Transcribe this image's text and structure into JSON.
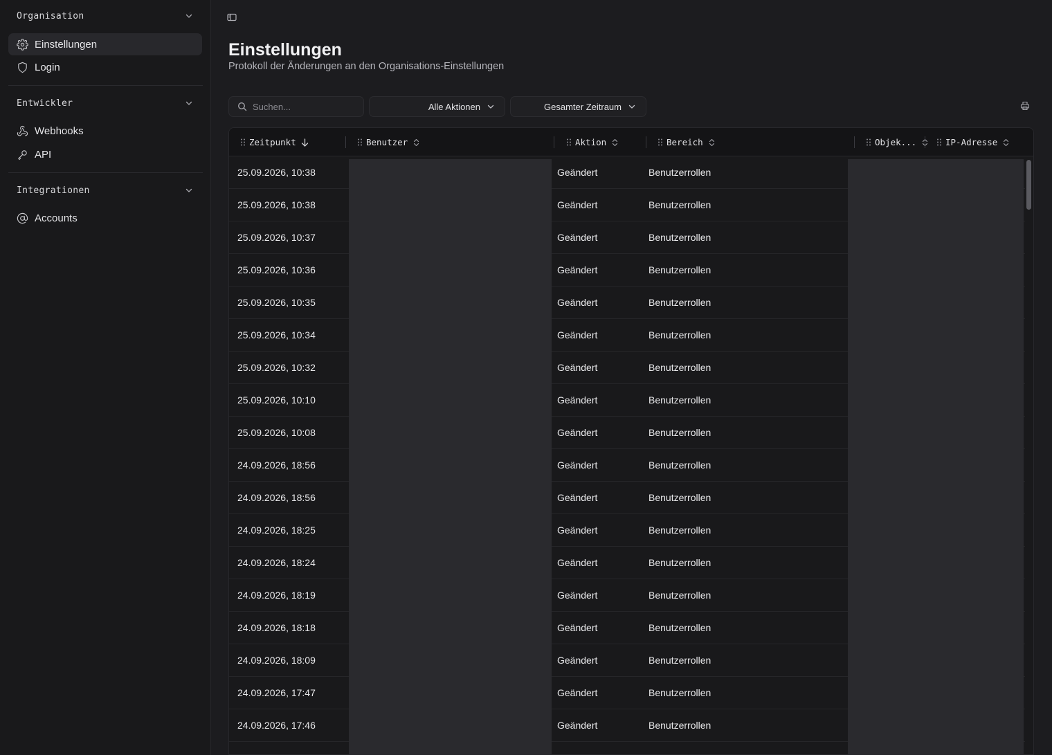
{
  "sidebar": {
    "groups": [
      {
        "title": "Organisation",
        "items": [
          {
            "label": "Einstellungen",
            "icon": "gear-icon",
            "active": true
          },
          {
            "label": "Login",
            "icon": "shield-icon",
            "active": false
          }
        ]
      },
      {
        "title": "Entwickler",
        "items": [
          {
            "label": "Webhooks",
            "icon": "webhook-icon",
            "active": false
          },
          {
            "label": "API",
            "icon": "key-icon",
            "active": false
          }
        ]
      },
      {
        "title": "Integrationen",
        "items": [
          {
            "label": "Accounts",
            "icon": "at-sign-icon",
            "active": false
          }
        ]
      }
    ]
  },
  "header": {
    "title": "Einstellungen",
    "subtitle": "Protokoll der Änderungen an den Organisations-Einstellungen"
  },
  "toolbar": {
    "search_placeholder": "Suchen...",
    "action_filter": "Alle Aktionen",
    "period_filter": "Gesamter Zeitraum"
  },
  "table": {
    "columns": [
      "Zeitpunkt",
      "Benutzer",
      "Aktion",
      "Bereich",
      "Objek...",
      "IP-Adresse"
    ],
    "rows": [
      {
        "time": "25.09.2026, 10:38",
        "action": "Geändert",
        "area": "Benutzerrollen"
      },
      {
        "time": "25.09.2026, 10:38",
        "action": "Geändert",
        "area": "Benutzerrollen"
      },
      {
        "time": "25.09.2026, 10:37",
        "action": "Geändert",
        "area": "Benutzerrollen"
      },
      {
        "time": "25.09.2026, 10:36",
        "action": "Geändert",
        "area": "Benutzerrollen"
      },
      {
        "time": "25.09.2026, 10:35",
        "action": "Geändert",
        "area": "Benutzerrollen"
      },
      {
        "time": "25.09.2026, 10:34",
        "action": "Geändert",
        "area": "Benutzerrollen"
      },
      {
        "time": "25.09.2026, 10:32",
        "action": "Geändert",
        "area": "Benutzerrollen"
      },
      {
        "time": "25.09.2026, 10:10",
        "action": "Geändert",
        "area": "Benutzerrollen"
      },
      {
        "time": "25.09.2026, 10:08",
        "action": "Geändert",
        "area": "Benutzerrollen"
      },
      {
        "time": "24.09.2026, 18:56",
        "action": "Geändert",
        "area": "Benutzerrollen"
      },
      {
        "time": "24.09.2026, 18:56",
        "action": "Geändert",
        "area": "Benutzerrollen"
      },
      {
        "time": "24.09.2026, 18:25",
        "action": "Geändert",
        "area": "Benutzerrollen"
      },
      {
        "time": "24.09.2026, 18:24",
        "action": "Geändert",
        "area": "Benutzerrollen"
      },
      {
        "time": "24.09.2026, 18:19",
        "action": "Geändert",
        "area": "Benutzerrollen"
      },
      {
        "time": "24.09.2026, 18:18",
        "action": "Geändert",
        "area": "Benutzerrollen"
      },
      {
        "time": "24.09.2026, 18:09",
        "action": "Geändert",
        "area": "Benutzerrollen"
      },
      {
        "time": "24.09.2026, 17:47",
        "action": "Geändert",
        "area": "Benutzerrollen"
      },
      {
        "time": "24.09.2026, 17:46",
        "action": "Geändert",
        "area": "Benutzerrollen"
      }
    ]
  }
}
